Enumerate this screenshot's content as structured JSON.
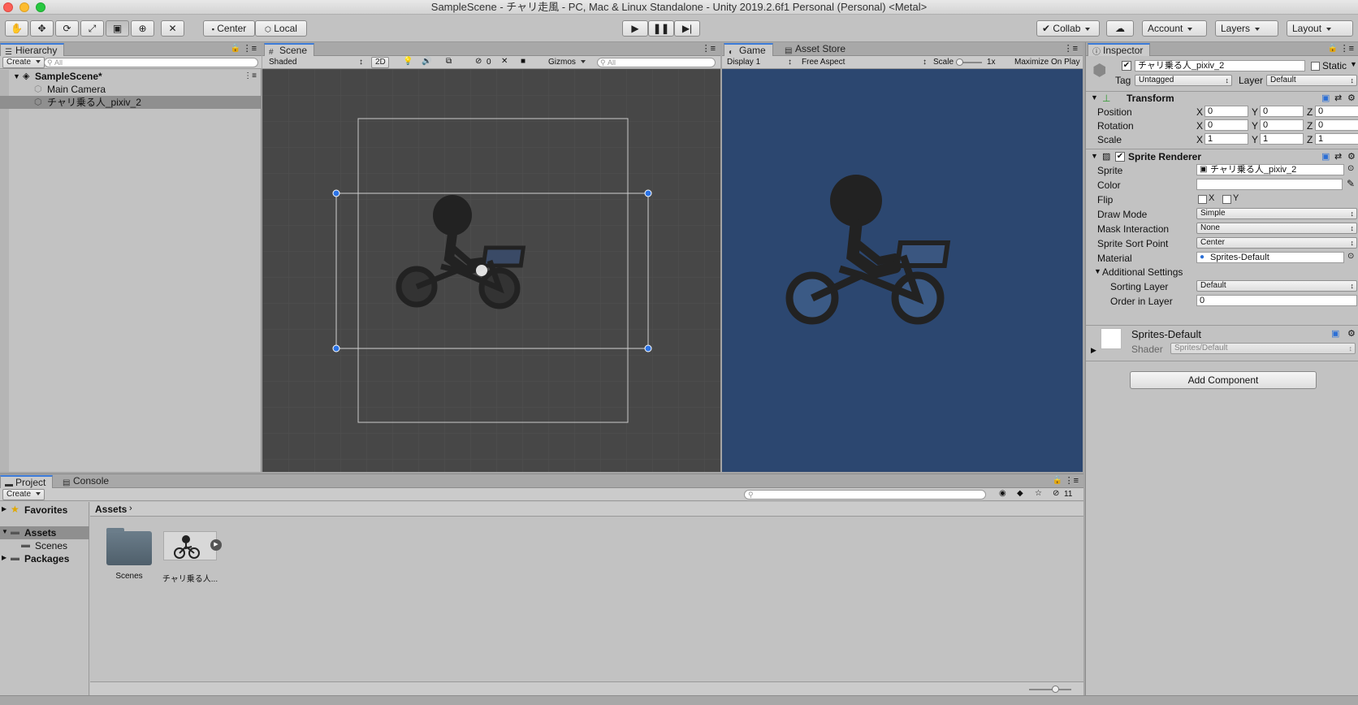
{
  "window": {
    "title": "SampleScene - チャリ走風 - PC, Mac & Linux Standalone - Unity 2019.2.6f1 Personal (Personal) <Metal>"
  },
  "toolbar": {
    "center_label": "Center",
    "local_label": "Local",
    "collab_label": "Collab",
    "account_label": "Account",
    "layers_label": "Layers",
    "layout_label": "Layout"
  },
  "hierarchy": {
    "tab_label": "Hierarchy",
    "create_label": "Create",
    "search_placeholder": "All",
    "scene_name": "SampleScene*",
    "items": [
      {
        "label": "Main Camera"
      },
      {
        "label": "チャリ乗る人_pixiv_2"
      }
    ]
  },
  "scene": {
    "tab_label": "Scene",
    "shading_mode": "Shaded",
    "mode_2d_label": "2D",
    "hidden_count": "0",
    "gizmos_label": "Gizmos",
    "search_placeholder": "All"
  },
  "game": {
    "tab_label": "Game",
    "asset_store_label": "Asset Store",
    "display_label": "Display 1",
    "aspect_label": "Free Aspect",
    "scale_label": "Scale",
    "scale_value": "1x",
    "maximize_label": "Maximize On Play",
    "background_color": "#2c4770"
  },
  "inspector": {
    "tab_label": "Inspector",
    "object_name": "チャリ乗る人_pixiv_2",
    "static_label": "Static",
    "tag_label": "Tag",
    "tag_value": "Untagged",
    "layer_label": "Layer",
    "layer_value": "Default",
    "transform": {
      "title": "Transform",
      "position_label": "Position",
      "rotation_label": "Rotation",
      "scale_label": "Scale",
      "x": "X",
      "y": "Y",
      "z": "Z",
      "position": [
        "0",
        "0",
        "0"
      ],
      "rotation": [
        "0",
        "0",
        "0"
      ],
      "scale": [
        "1",
        "1",
        "1"
      ]
    },
    "sprite_renderer": {
      "title": "Sprite Renderer",
      "sprite_label": "Sprite",
      "sprite_value": "チャリ乗る人_pixiv_2",
      "color_label": "Color",
      "flip_label": "Flip",
      "flip_x": "X",
      "flip_y": "Y",
      "draw_mode_label": "Draw Mode",
      "draw_mode_value": "Simple",
      "mask_label": "Mask Interaction",
      "mask_value": "None",
      "sort_point_label": "Sprite Sort Point",
      "sort_point_value": "Center",
      "material_label": "Material",
      "material_value": "Sprites-Default",
      "additional_label": "Additional Settings",
      "sorting_layer_label": "Sorting Layer",
      "sorting_layer_value": "Default",
      "order_label": "Order in Layer",
      "order_value": "0"
    },
    "material": {
      "name": "Sprites-Default",
      "shader_label": "Shader",
      "shader_value": "Sprites/Default"
    },
    "add_component_label": "Add Component"
  },
  "project": {
    "tab_label": "Project",
    "console_label": "Console",
    "create_label": "Create",
    "hidden_count": "11",
    "favorites_label": "Favorites",
    "assets_label": "Assets",
    "scenes_label": "Scenes",
    "packages_label": "Packages",
    "breadcrumb": "Assets",
    "assets": [
      {
        "label": "Scenes"
      },
      {
        "label": "チャリ乗る人..."
      }
    ]
  }
}
